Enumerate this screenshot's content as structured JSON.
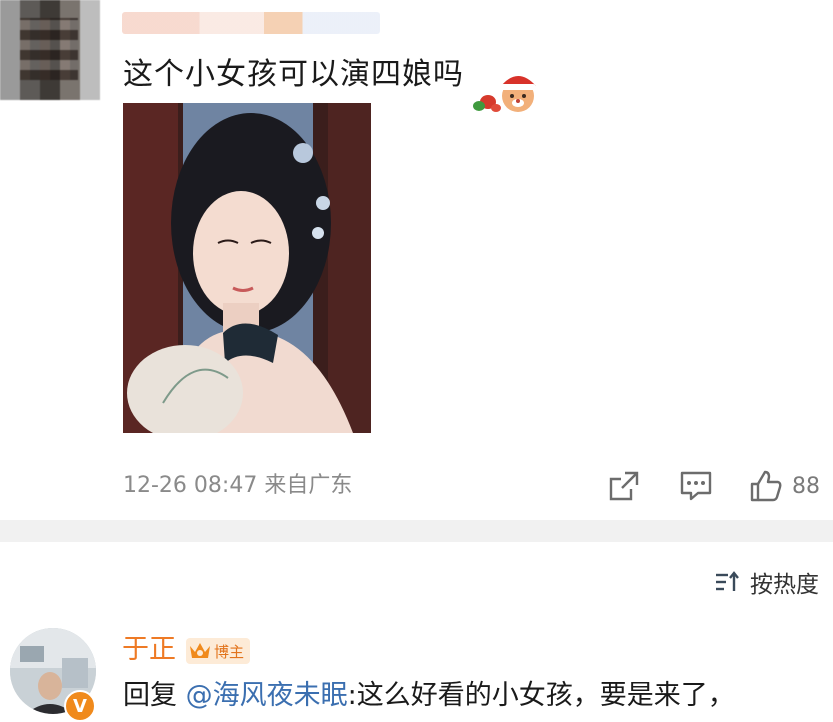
{
  "comment": {
    "author_name": "",
    "text": "这个小女孩可以演四娘吗",
    "sticker_icon": "santa-bear-sticker-icon",
    "timestamp": "12-26 08:47",
    "location": "来自广东",
    "actions": {
      "share_icon": "share-icon",
      "reply_icon": "comment-icon",
      "like_icon": "thumbs-up-icon",
      "like_count": "88"
    }
  },
  "sort": {
    "icon": "sort-icon",
    "label": "按热度"
  },
  "reply": {
    "author_name": "于正",
    "author_tag": "博主",
    "verified_badge": "V",
    "prefix": "回复",
    "mention": "@海风夜未眠",
    "text": ":这么好看的小女孩，要是来了，"
  },
  "colors": {
    "accent_orange": "#ee7a25",
    "mention_blue": "#3b6fb0",
    "meta_gray": "#8a8a8a",
    "divider": "#f1f1f1"
  }
}
